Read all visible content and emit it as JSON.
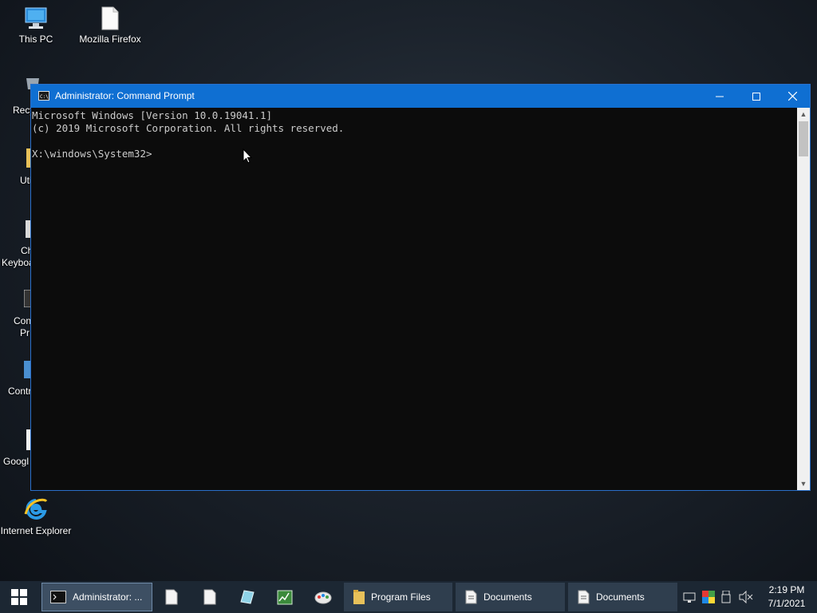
{
  "desktop": {
    "icons": [
      {
        "name": "this-pc",
        "label": "This PC"
      },
      {
        "name": "mozilla-firefox",
        "label": "Mozilla Firefox"
      },
      {
        "name": "internet-explorer",
        "label": "Internet Explorer"
      }
    ],
    "partial_labels": [
      "Recy",
      "Uti",
      "Ch",
      "Keyboa",
      "Con",
      "Pr",
      "Contr",
      "Googl"
    ]
  },
  "cmd_window": {
    "title": "Administrator: Command Prompt",
    "lines": [
      "Microsoft Windows [Version 10.0.19041.1]",
      "(c) 2019 Microsoft Corporation. All rights reserved.",
      "",
      "X:\\windows\\System32>"
    ]
  },
  "taskbar": {
    "active_task": "Administrator: ...",
    "tasks": [
      "Program Files",
      "Documents",
      "Documents"
    ],
    "clock": {
      "time": "2:19 PM",
      "date": "7/1/2021"
    }
  },
  "colors": {
    "titlebar": "#0f6fd2",
    "console_bg": "#0c0c0c",
    "console_text": "#cccccc",
    "taskbar": "#1c2733"
  }
}
